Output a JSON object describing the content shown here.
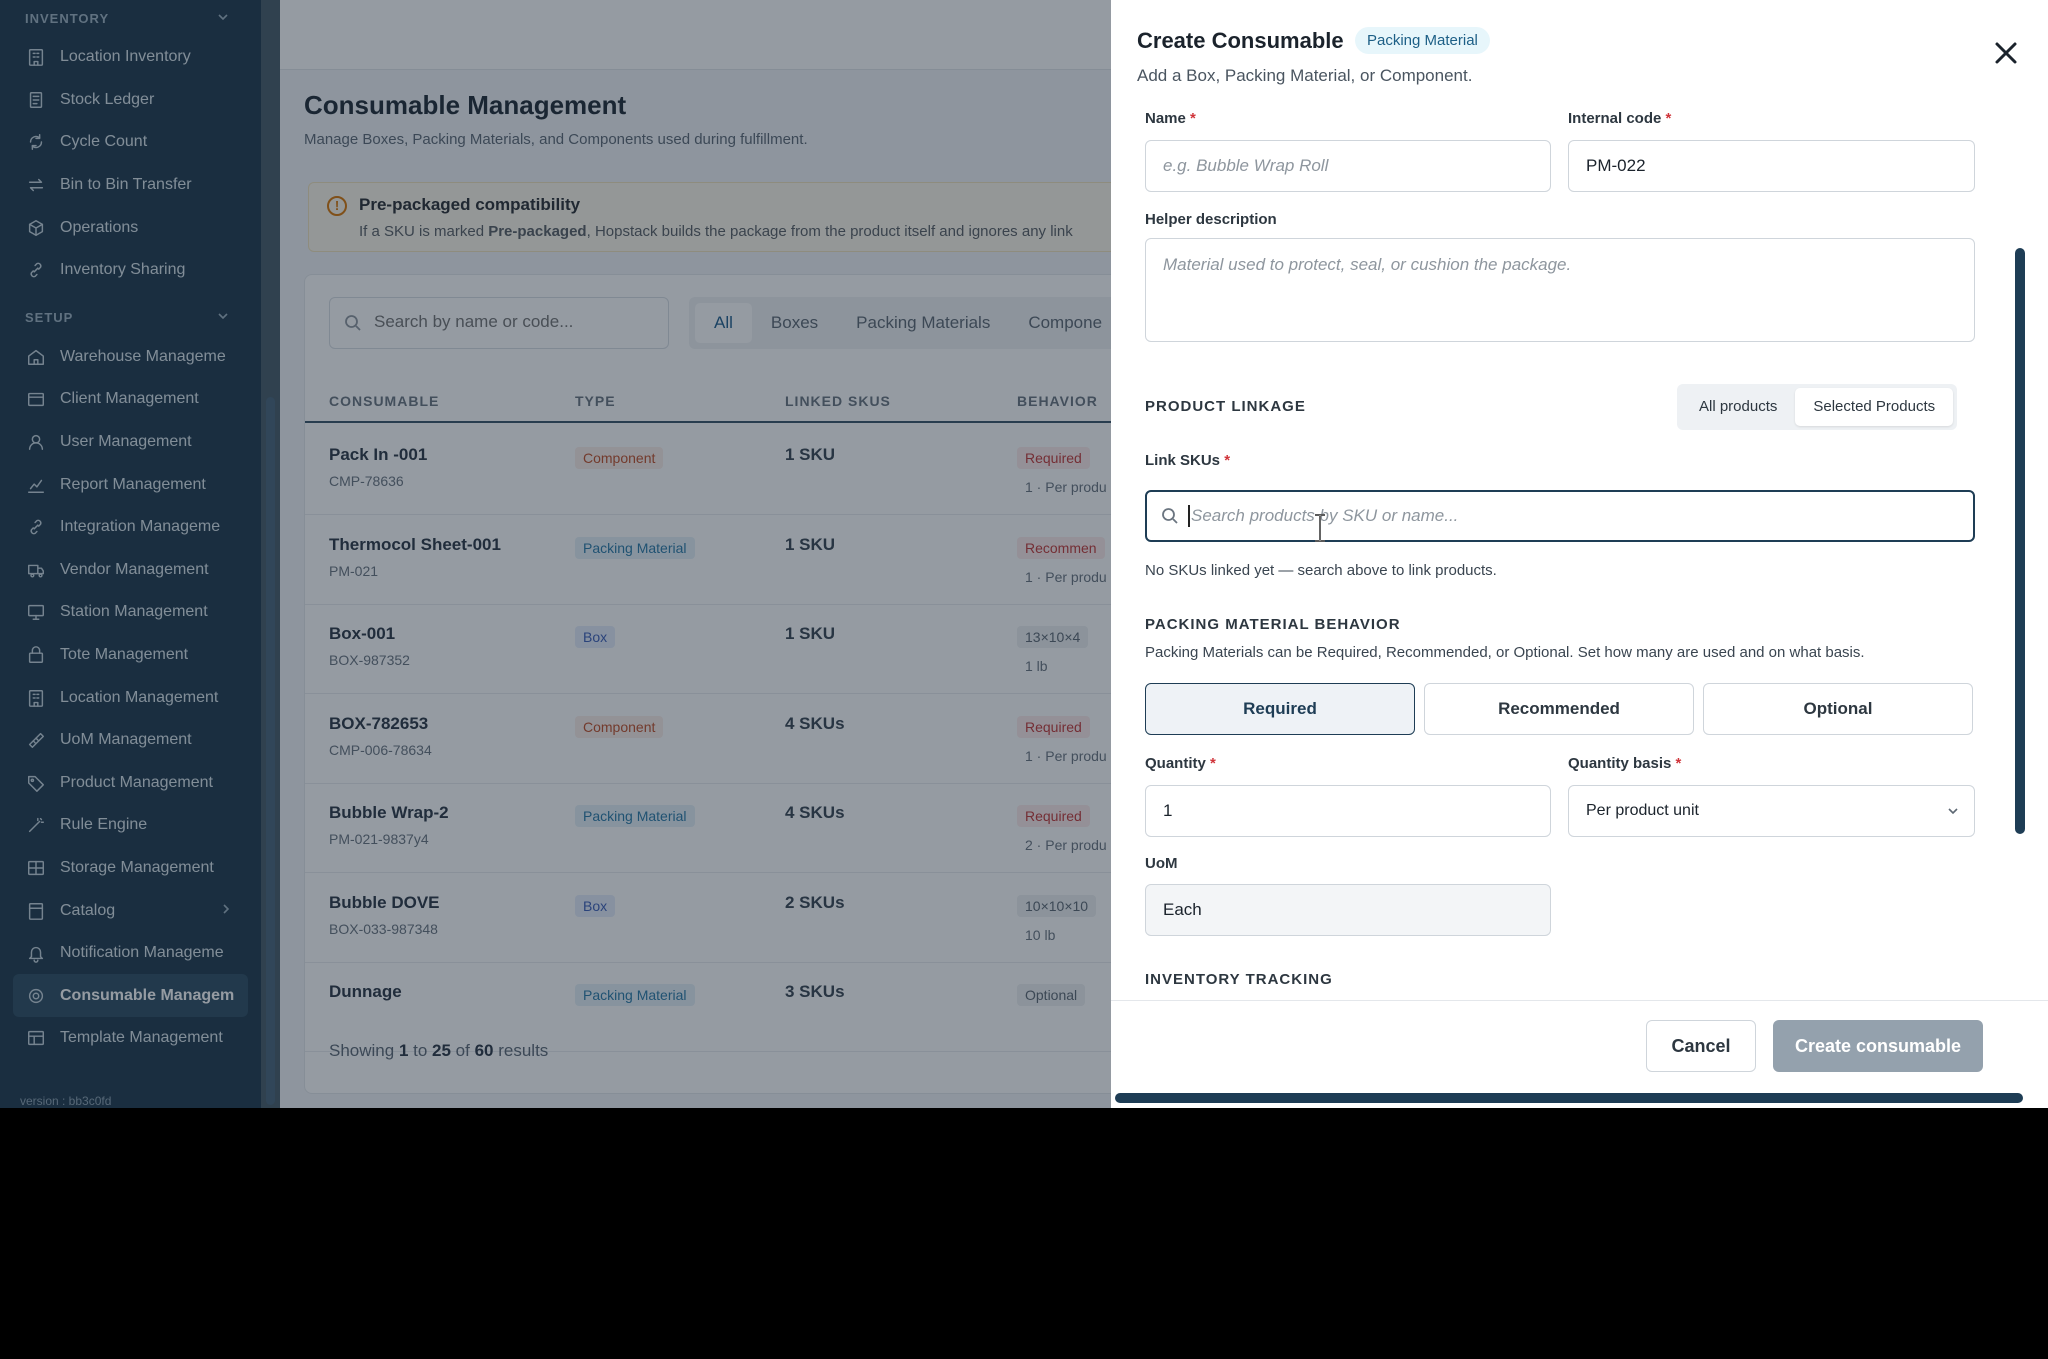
{
  "sidebar": {
    "inventory_section": "INVENTORY",
    "inventory_items": [
      {
        "label": "Location Inventory",
        "icon": "building-icon"
      },
      {
        "label": "Stock Ledger",
        "icon": "ledger-icon"
      },
      {
        "label": "Cycle Count",
        "icon": "cycle-icon"
      },
      {
        "label": "Bin to Bin Transfer",
        "icon": "transfer-icon"
      },
      {
        "label": "Operations",
        "icon": "box-icon"
      },
      {
        "label": "Inventory Sharing",
        "icon": "link-icon"
      }
    ],
    "setup_section": "SETUP",
    "setup_items": [
      {
        "label": "Warehouse Manageme",
        "icon": "home-icon"
      },
      {
        "label": "Client Management",
        "icon": "clients-icon"
      },
      {
        "label": "User Management",
        "icon": "user-icon"
      },
      {
        "label": "Report Management",
        "icon": "chart-icon"
      },
      {
        "label": "Integration Manageme",
        "icon": "link-icon"
      },
      {
        "label": "Vendor Management",
        "icon": "truck-icon"
      },
      {
        "label": "Station Management",
        "icon": "monitor-icon"
      },
      {
        "label": "Tote Management",
        "icon": "tote-icon"
      },
      {
        "label": "Location Management",
        "icon": "building-icon"
      },
      {
        "label": "UoM Management",
        "icon": "ruler-icon"
      },
      {
        "label": "Product Management",
        "icon": "tag-icon"
      },
      {
        "label": "Rule Engine",
        "icon": "wand-icon"
      },
      {
        "label": "Storage Management",
        "icon": "grid-icon"
      },
      {
        "label": "Catalog",
        "icon": "catalog-icon"
      },
      {
        "label": "Notification Manageme",
        "icon": "bell-icon"
      },
      {
        "label": "Consumable Managem",
        "icon": "consumable-icon"
      },
      {
        "label": "Template Management",
        "icon": "template-icon"
      }
    ],
    "version": "version : bb3c0fd"
  },
  "main": {
    "title": "Consumable Management",
    "subtitle": "Manage Boxes, Packing Materials, and Components used during fulfillment.",
    "notice": {
      "title": "Pre-packaged compatibility",
      "text_before": "If a SKU is marked ",
      "text_bold": "Pre-packaged",
      "text_after": ", Hopstack builds the package from the product itself and ignores any link"
    },
    "search_placeholder": "Search by name or code...",
    "filter_tabs": [
      "All",
      "Boxes",
      "Packing Materials",
      "Compone"
    ],
    "columns": [
      "CONSUMABLE",
      "TYPE",
      "LINKED SKUS",
      "BEHAVIOR"
    ],
    "rows": [
      {
        "name": "Pack In -001",
        "code": "CMP-78636",
        "type": "Component",
        "type_key": "Component",
        "skus": "1 SKU",
        "behavior": "Required",
        "beh_key": "Required",
        "detail": "1 · Per produ"
      },
      {
        "name": "Thermocol Sheet-001",
        "code": "PM-021",
        "type": "Packing Material",
        "type_key": "Packing",
        "skus": "1 SKU",
        "behavior": "Recommen",
        "beh_key": "Recommended",
        "detail": "1 · Per produ"
      },
      {
        "name": "Box-001",
        "code": "BOX-987352",
        "type": "Box",
        "type_key": "Box",
        "skus": "1 SKU",
        "behavior": "13×10×4",
        "beh_key": "dim",
        "detail": "1 lb"
      },
      {
        "name": "BOX-782653",
        "code": "CMP-006-78634",
        "type": "Component",
        "type_key": "Component",
        "skus": "4 SKUs",
        "behavior": "Required",
        "beh_key": "Required",
        "detail": "1 · Per produ"
      },
      {
        "name": "Bubble Wrap-2",
        "code": "PM-021-9837y4",
        "type": "Packing Material",
        "type_key": "Packing",
        "skus": "4 SKUs",
        "behavior": "Required",
        "beh_key": "Required",
        "detail": "2 · Per produ"
      },
      {
        "name": "Bubble DOVE",
        "code": "BOX-033-987348",
        "type": "Box",
        "type_key": "Box",
        "skus": "2 SKUs",
        "behavior": "10×10×10",
        "beh_key": "dim",
        "detail": "10 lb"
      },
      {
        "name": "Dunnage",
        "code": "",
        "type": "Packing Material",
        "type_key": "Packing",
        "skus": "3 SKUs",
        "behavior": "Optional",
        "beh_key": "Optional",
        "detail": ""
      }
    ],
    "showing": {
      "prefix": "Showing ",
      "from": "1",
      "mid1": " to ",
      "to": "25",
      "mid2": " of ",
      "total": "60",
      "suffix": " results"
    }
  },
  "drawer": {
    "title": "Create Consumable",
    "badge": "Packing Material",
    "subtitle": "Add a Box, Packing Material, or Component.",
    "name_label": "Name",
    "name_placeholder": "e.g. Bubble Wrap Roll",
    "code_label": "Internal code",
    "code_value": "PM-022",
    "helper_label": "Helper description",
    "helper_placeholder": "Material used to protect, seal, or cushion the package.",
    "linkage_title": "PRODUCT LINKAGE",
    "linkage_options": [
      "All products",
      "Selected Products"
    ],
    "link_skus_label": "Link SKUs",
    "sku_search_placeholder": "Search products by SKU or name...",
    "sku_empty": "No SKUs linked yet — search above to link products.",
    "behavior_title": "PACKING MATERIAL BEHAVIOR",
    "behavior_desc": "Packing Materials can be Required, Recommended, or Optional. Set how many are used and on what basis.",
    "behavior_options": [
      "Required",
      "Recommended",
      "Optional"
    ],
    "quantity_label": "Quantity",
    "quantity_value": "1",
    "basis_label": "Quantity basis",
    "basis_value": "Per product unit",
    "uom_label": "UoM",
    "uom_value": "Each",
    "tracking_title": "INVENTORY TRACKING",
    "required_mark": "*",
    "cancel_label": "Cancel",
    "create_label": "Create consumable"
  },
  "colors": {
    "sidebar": "#1f3a4d",
    "accent": "#1e3d55",
    "badge_bg": "#e7f6fb",
    "required": "#d0343a"
  }
}
